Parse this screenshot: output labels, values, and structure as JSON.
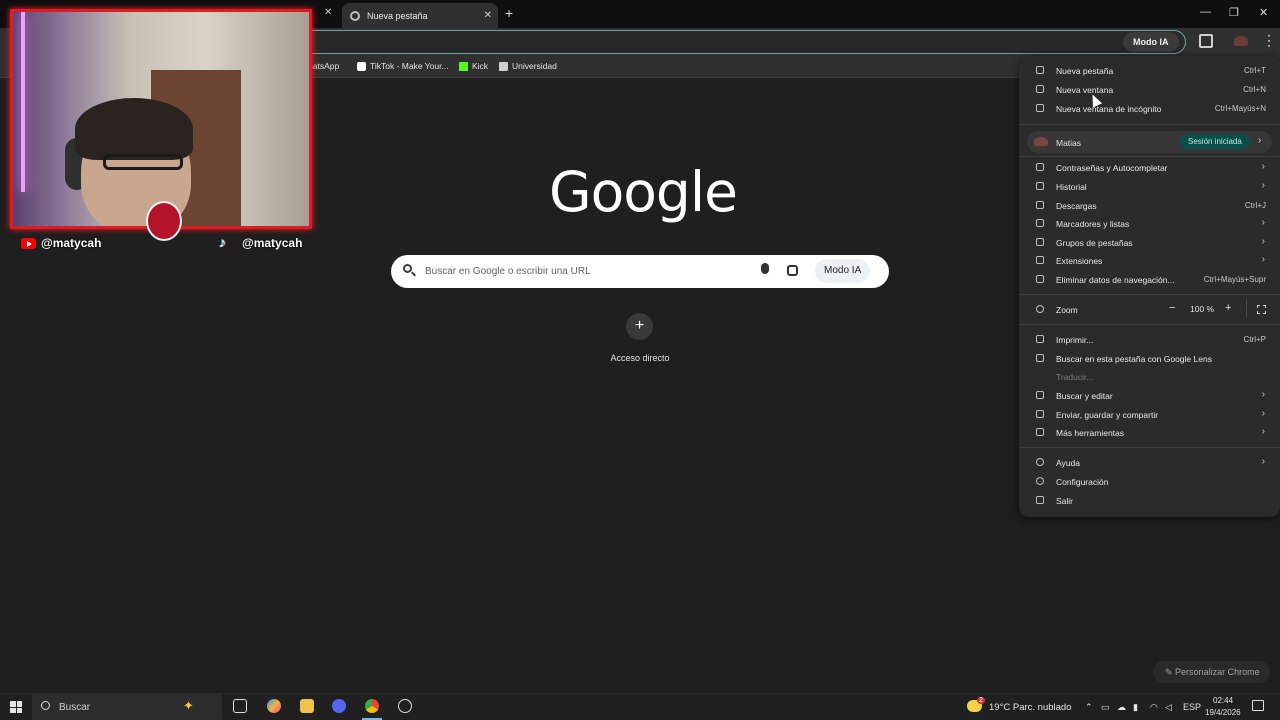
{
  "tabs": {
    "active_title": "Nueva pestaña",
    "close_glyph": "✕",
    "new_tab_glyph": "+"
  },
  "window_controls": {
    "minimize": "—",
    "restore": "❐",
    "close": "✕"
  },
  "toolbar": {
    "modo_ia": "Modo IA",
    "menu_glyph": "⋮"
  },
  "bookmarks": [
    {
      "label": "WhatsApp",
      "icon": "whatsapp-icon",
      "color": "#25d366"
    },
    {
      "label": "TikTok - Make Your...",
      "icon": "tiktok-icon",
      "color": "#ffffff"
    },
    {
      "label": "Kick",
      "icon": "kick-icon",
      "color": "#53fc18"
    },
    {
      "label": "Universidad",
      "icon": "folder-icon",
      "color": "#e3e3e3"
    }
  ],
  "page": {
    "logo": "Google",
    "search_placeholder": "Buscar en Google o escribir una URL",
    "search_modo_ia": "Modo IA",
    "shortcut_plus": "+",
    "shortcut_label": "Acceso directo",
    "customize": "Personalizar Chrome"
  },
  "menu": {
    "items_top": [
      {
        "label": "Nueva pestaña",
        "shortcut": "Ctrl+T",
        "icon": "new-tab-icon"
      },
      {
        "label": "Nueva ventana",
        "shortcut": "Ctrl+N",
        "icon": "new-window-icon"
      },
      {
        "label": "Nueva ventana de incógnito",
        "shortcut": "Ctrl+Mayús+N",
        "icon": "incognito-icon"
      }
    ],
    "profile": {
      "name": "Matias",
      "badge": "Sesión iniciada",
      "arrow": "›"
    },
    "items_mid": [
      {
        "label": "Contraseñas y Autocompletar",
        "shortcut": "›",
        "icon": "key-icon"
      },
      {
        "label": "Historial",
        "shortcut": "›",
        "icon": "history-icon"
      },
      {
        "label": "Descargas",
        "shortcut": "Ctrl+J",
        "icon": "download-icon"
      },
      {
        "label": "Marcadores y listas",
        "shortcut": "›",
        "icon": "star-icon"
      },
      {
        "label": "Grupos de pestañas",
        "shortcut": "›",
        "icon": "tab-groups-icon"
      },
      {
        "label": "Extensiones",
        "shortcut": "›",
        "icon": "puzzle-icon"
      },
      {
        "label": "Eliminar datos de navegación...",
        "shortcut": "Ctrl+Mayús+Supr",
        "icon": "trash-icon"
      }
    ],
    "zoom": {
      "label": "Zoom",
      "minus": "−",
      "value": "100 %",
      "plus": "+"
    },
    "items_tools": [
      {
        "label": "Imprimir...",
        "shortcut": "Ctrl+P",
        "icon": "print-icon"
      },
      {
        "label": "Buscar en esta pestaña con Google Lens",
        "shortcut": "",
        "icon": "lens-icon"
      },
      {
        "label": "Traducir...",
        "shortcut": "",
        "icon": "translate-icon",
        "disabled": true
      },
      {
        "label": "Buscar y editar",
        "shortcut": "›",
        "icon": "find-icon"
      },
      {
        "label": "Enviar, guardar y compartir",
        "shortcut": "›",
        "icon": "share-icon"
      },
      {
        "label": "Más herramientas",
        "shortcut": "›",
        "icon": "toolbox-icon"
      }
    ],
    "items_bottom": [
      {
        "label": "Ayuda",
        "shortcut": "›",
        "icon": "help-icon"
      },
      {
        "label": "Configuración",
        "shortcut": "",
        "icon": "settings-icon"
      },
      {
        "label": "Salir",
        "shortcut": "",
        "icon": "exit-icon"
      }
    ]
  },
  "webcam": {
    "youtube_handle": "@matycah",
    "tiktok_handle": "@matycah",
    "border_color": "#e11b22"
  },
  "taskbar": {
    "search_label": "Buscar",
    "weather": "19°C  Parc. nublado",
    "weather_badge": "2",
    "lang": "ESP",
    "time": "02:44",
    "date": "19/4/2026"
  }
}
